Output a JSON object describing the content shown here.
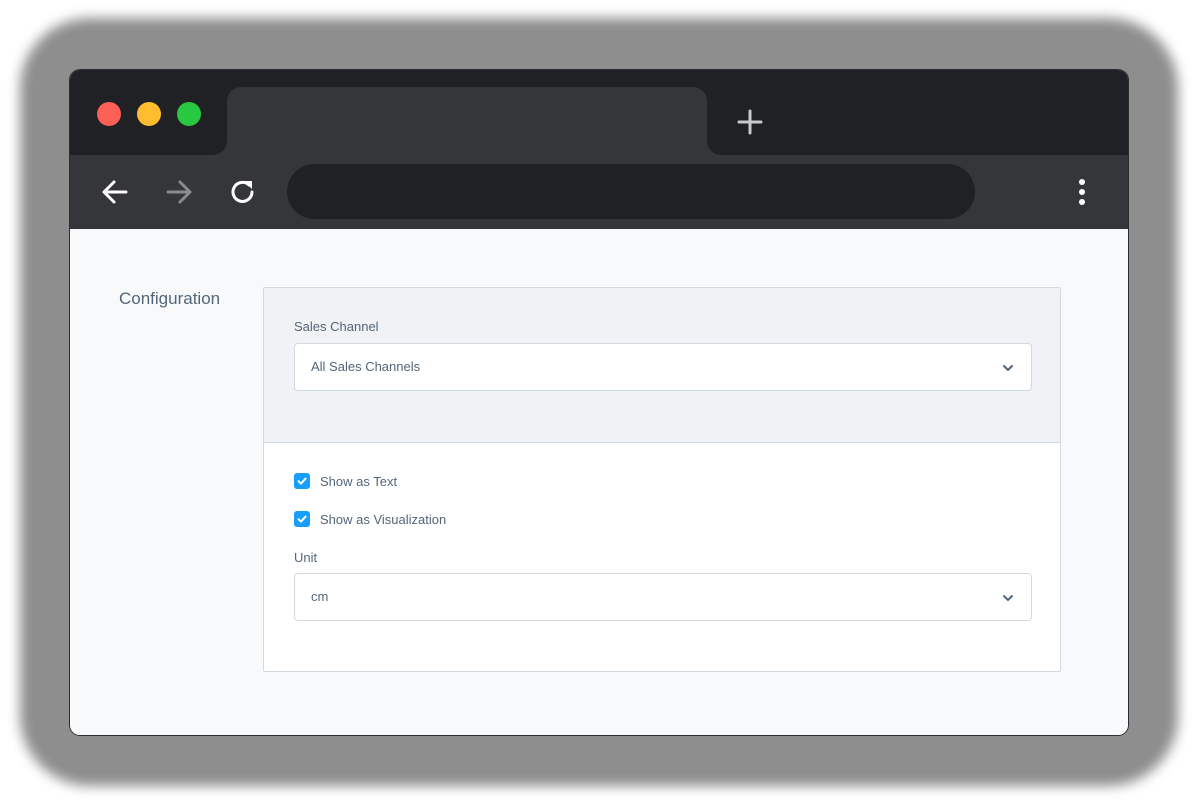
{
  "browser": {
    "traffic_lights": [
      "close-button",
      "minimize-button",
      "maximize-button"
    ],
    "new_tab_icon": "plus-icon",
    "nav": [
      "back-arrow-icon",
      "forward-arrow-icon",
      "reload-icon"
    ],
    "menu_icon": "more-vertical-icon"
  },
  "page": {
    "section_label": "Configuration",
    "sales_channel": {
      "label": "Sales Channel",
      "value": "All Sales Channels"
    },
    "options": [
      {
        "label": "Show as Text",
        "checked": true
      },
      {
        "label": "Show as Visualization",
        "checked": true
      }
    ],
    "unit": {
      "label": "Unit",
      "value": "cm"
    }
  },
  "colors": {
    "accent": "#189eff",
    "titlebar": "#202124",
    "toolbar": "#35363a",
    "text": "#52667a"
  }
}
